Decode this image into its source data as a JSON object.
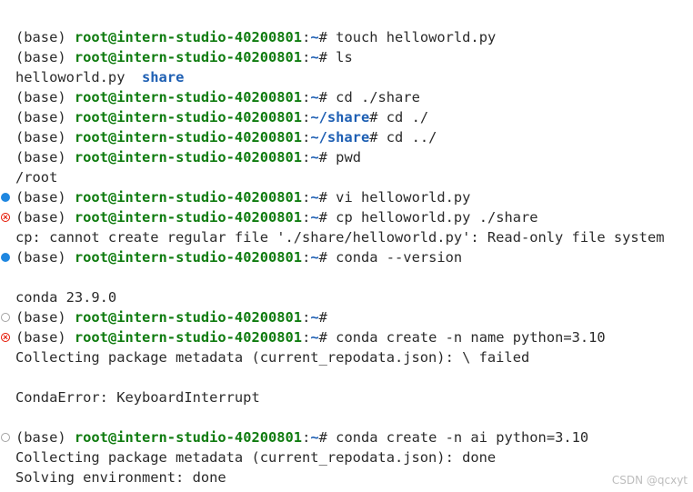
{
  "prompt": {
    "env": "(base) ",
    "user_host": "root@intern-studio-40200801",
    "colon": ":",
    "home": "~",
    "share": "~/share",
    "suffix": "# "
  },
  "lines": [
    {
      "type": "prompt",
      "path": "~",
      "cmd": "touch helloworld.py"
    },
    {
      "type": "prompt",
      "path": "~",
      "cmd": "ls"
    },
    {
      "type": "ls",
      "file": "helloworld.py",
      "gap": "  ",
      "dir": "share"
    },
    {
      "type": "prompt",
      "path": "~",
      "cmd": "cd ./share"
    },
    {
      "type": "prompt",
      "path": "~/share",
      "cmd": "cd ./"
    },
    {
      "type": "prompt",
      "path": "~/share",
      "cmd": "cd ../"
    },
    {
      "type": "prompt",
      "path": "~",
      "cmd": "pwd"
    },
    {
      "type": "output",
      "text": "/root"
    },
    {
      "type": "prompt",
      "path": "~",
      "cmd": "vi helloworld.py",
      "deco": "info"
    },
    {
      "type": "prompt",
      "path": "~",
      "cmd": "cp helloworld.py ./share",
      "deco": "error"
    },
    {
      "type": "output",
      "text": "cp: cannot create regular file './share/helloworld.py': Read-only file system"
    },
    {
      "type": "prompt",
      "path": "~",
      "cmd": "conda --version",
      "deco": "info"
    },
    {
      "type": "output",
      "text": ""
    },
    {
      "type": "output",
      "text": "conda 23.9.0"
    },
    {
      "type": "prompt",
      "path": "~",
      "cmd": "",
      "deco": "empty"
    },
    {
      "type": "prompt",
      "path": "~",
      "cmd": "conda create -n name python=3.10",
      "deco": "error"
    },
    {
      "type": "output",
      "text": "Collecting package metadata (current_repodata.json): \\ failed"
    },
    {
      "type": "output",
      "text": ""
    },
    {
      "type": "output",
      "text": "CondaError: KeyboardInterrupt"
    },
    {
      "type": "output",
      "text": ""
    },
    {
      "type": "prompt",
      "path": "~",
      "cmd": "conda create -n ai python=3.10",
      "deco": "empty"
    },
    {
      "type": "output",
      "text": "Collecting package metadata (current_repodata.json): done"
    },
    {
      "type": "output",
      "text": "Solving environment: done"
    }
  ],
  "watermark": "CSDN @qcxyt",
  "colors": {
    "user": "#107c10",
    "path": "#1e5fb3",
    "info_deco": "#1f87e0",
    "error_deco": "#e51400",
    "empty_deco": "#a3a3a3",
    "text": "#2b2b2b",
    "background": "#ffffff"
  }
}
